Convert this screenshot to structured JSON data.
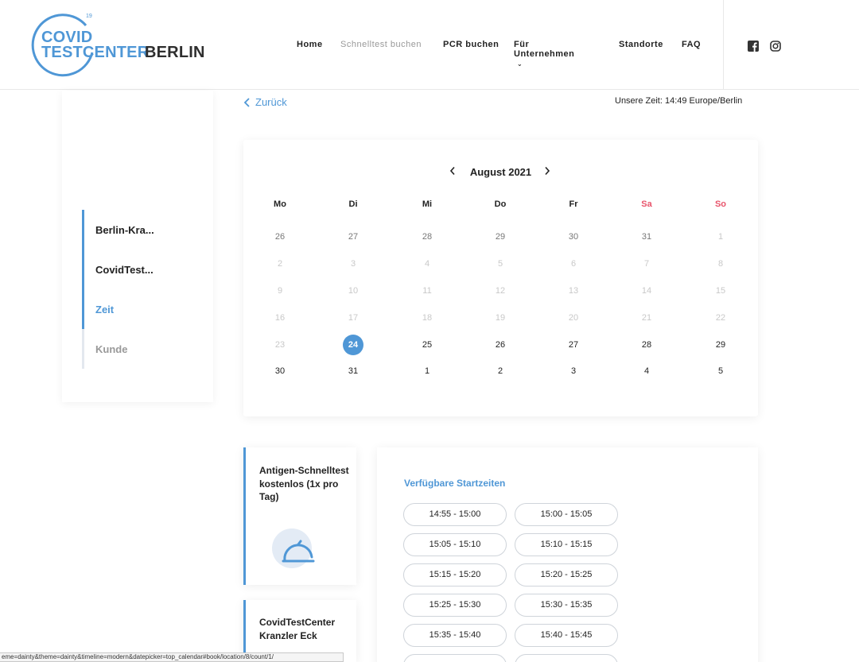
{
  "header": {
    "logo": {
      "line1": "COVID",
      "line2": "TESTCENTER",
      "line3": "BERLIN",
      "superscript": "19"
    },
    "nav": [
      {
        "label": "Home"
      },
      {
        "label": "Schnelltest buchen"
      },
      {
        "label": "PCR buchen"
      },
      {
        "label": "Für Unternehmen"
      },
      {
        "label": "Standorte"
      },
      {
        "label": "FAQ"
      }
    ],
    "social": [
      "facebook-icon",
      "instagram-icon"
    ]
  },
  "sidebar": {
    "steps": [
      {
        "label": "Berlin-Kra...",
        "state": "done"
      },
      {
        "label": "CovidTest...",
        "state": "done"
      },
      {
        "label": "Zeit",
        "state": "active"
      },
      {
        "label": "Kunde",
        "state": "pending"
      }
    ]
  },
  "topbar": {
    "back_label": "Zurück",
    "time_info": "Unsere Zeit: 14:49 Europe/Berlin"
  },
  "calendar": {
    "month_label": "August 2021",
    "weekdays": [
      "Mo",
      "Di",
      "Mi",
      "Do",
      "Fr",
      "Sa",
      "So"
    ],
    "weekend_color": "#e8546b",
    "accent_color": "#4f97d6",
    "weeks": [
      [
        [
          "26",
          "out"
        ],
        [
          "27",
          "out"
        ],
        [
          "28",
          "out"
        ],
        [
          "29",
          "out"
        ],
        [
          "30",
          "out"
        ],
        [
          "31",
          "out"
        ],
        [
          "1",
          "dis"
        ]
      ],
      [
        [
          "2",
          "dis"
        ],
        [
          "3",
          "dis"
        ],
        [
          "4",
          "dis"
        ],
        [
          "5",
          "dis"
        ],
        [
          "6",
          "dis"
        ],
        [
          "7",
          "dis"
        ],
        [
          "8",
          "dis"
        ]
      ],
      [
        [
          "9",
          "dis"
        ],
        [
          "10",
          "dis"
        ],
        [
          "11",
          "dis"
        ],
        [
          "12",
          "dis"
        ],
        [
          "13",
          "dis"
        ],
        [
          "14",
          "dis"
        ],
        [
          "15",
          "dis"
        ]
      ],
      [
        [
          "16",
          "dis"
        ],
        [
          "17",
          "dis"
        ],
        [
          "18",
          "dis"
        ],
        [
          "19",
          "dis"
        ],
        [
          "20",
          "dis"
        ],
        [
          "21",
          "dis"
        ],
        [
          "22",
          "dis"
        ]
      ],
      [
        [
          "23",
          "dis"
        ],
        [
          "24",
          "sel"
        ],
        [
          "25",
          "av"
        ],
        [
          "26",
          "av"
        ],
        [
          "27",
          "av"
        ],
        [
          "28",
          "av"
        ],
        [
          "29",
          "av"
        ]
      ],
      [
        [
          "30",
          "av"
        ],
        [
          "31",
          "av"
        ],
        [
          "1",
          "av"
        ],
        [
          "2",
          "av"
        ],
        [
          "3",
          "av"
        ],
        [
          "4",
          "av"
        ],
        [
          "5",
          "av"
        ]
      ]
    ]
  },
  "service": {
    "title": "Antigen-Schnelltest kostenlos (1x pro Tag)",
    "icon": "food-cover-icon"
  },
  "location": {
    "title": "CovidTestCenter Kranzler Eck"
  },
  "slots": {
    "title": "Verfügbare Startzeiten",
    "items": [
      "14:55 - 15:00",
      "15:00 - 15:05",
      "15:05 - 15:10",
      "15:10 - 15:15",
      "15:15 - 15:20",
      "15:20 - 15:25",
      "15:25 - 15:30",
      "15:30 - 15:35",
      "15:35 - 15:40",
      "15:40 - 15:45",
      "",
      ""
    ]
  },
  "statusbar": {
    "url": "eme=dainty&theme=dainty&timeline=modern&datepicker=top_calendar#book/location/8/count/1/"
  }
}
